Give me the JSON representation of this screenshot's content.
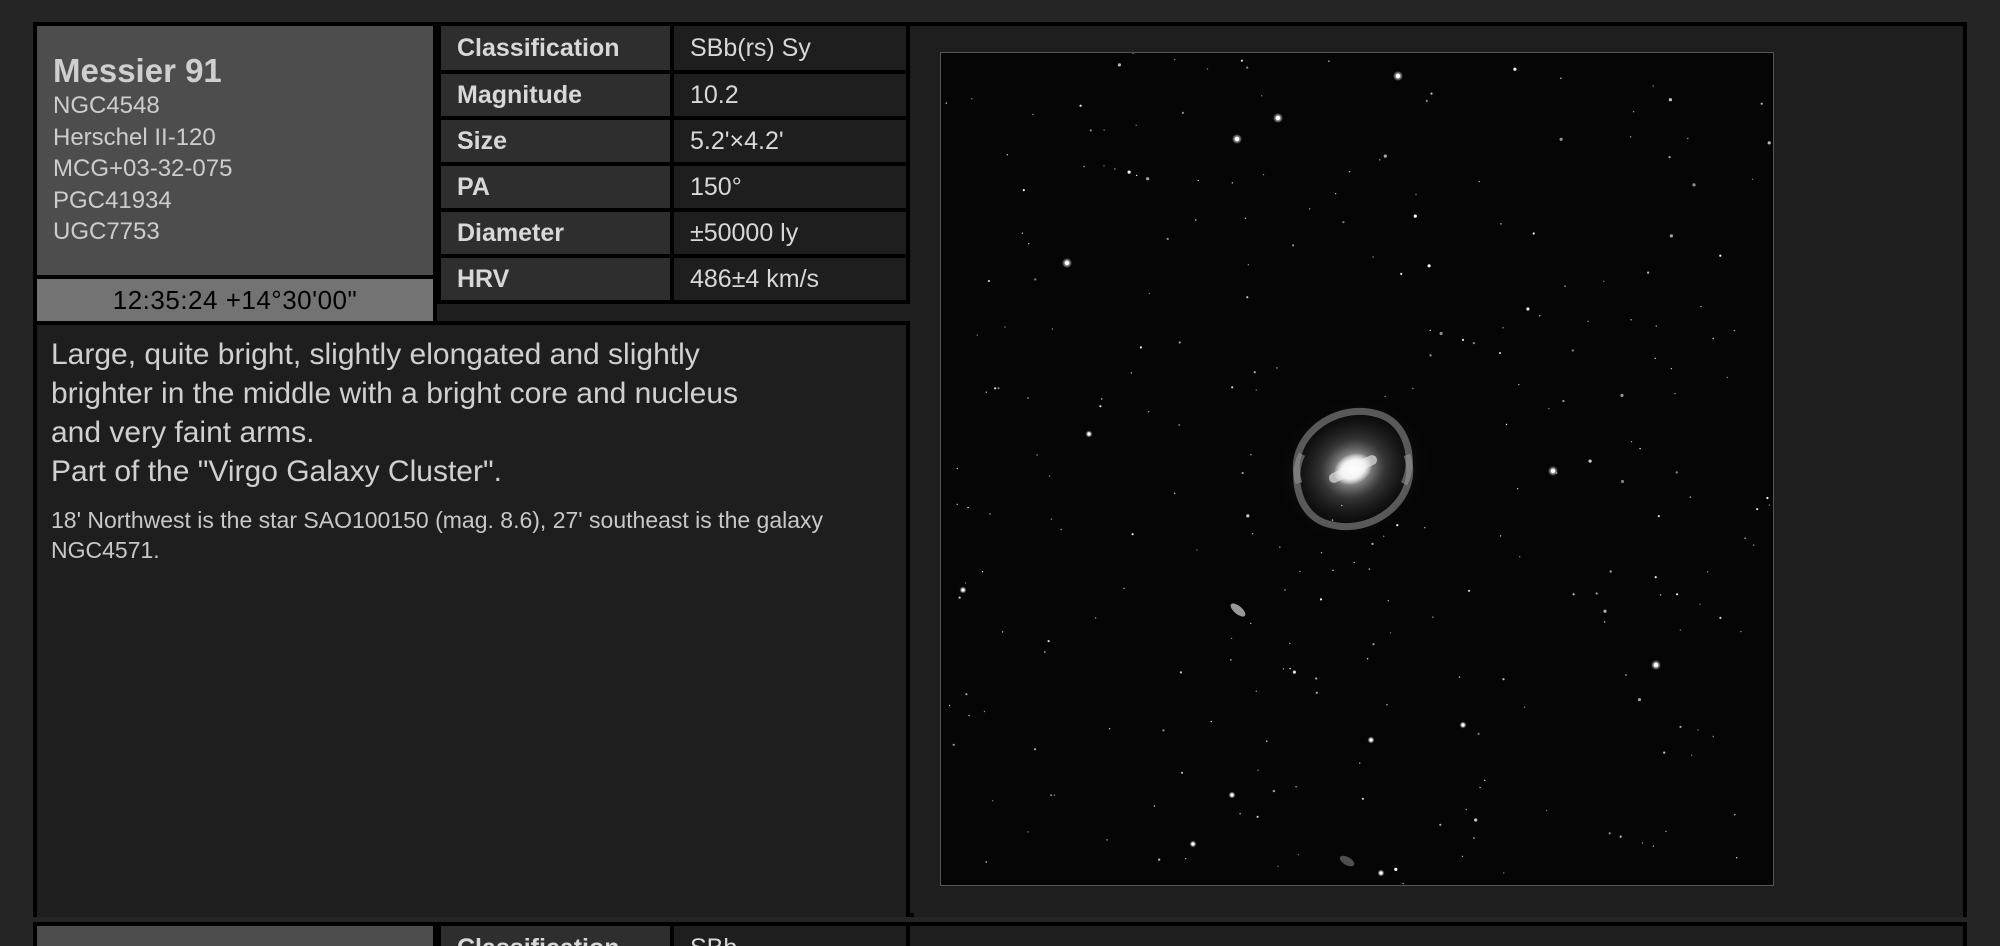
{
  "entries": [
    {
      "name": "Messier 91",
      "aliases": [
        "NGC4548",
        "Herschel II-120",
        "MCG+03-32-075",
        "PGC41934",
        "UGC7753"
      ],
      "coordinates": "12:35:24 +14°30'00\"",
      "properties": [
        {
          "label": "Classification",
          "value": "SBb(rs) Sy"
        },
        {
          "label": "Magnitude",
          "value": "10.2"
        },
        {
          "label": "Size",
          "value": "5.2'×4.2'"
        },
        {
          "label": "PA",
          "value": "150°"
        },
        {
          "label": "Diameter",
          "value": "±50000 ly"
        },
        {
          "label": "HRV",
          "value": "486±4 km/s"
        }
      ],
      "description_lines": [
        "Large, quite bright, slightly elongated and slightly",
        "brighter in the middle with a bright core and nucleus",
        "and very faint arms.",
        "Part of the \"Virgo Galaxy Cluster\"."
      ],
      "description_extra": "18' Northwest is the star SAO100150 (mag. 8.6), 27' southeast is the galaxy NGC4571."
    },
    {
      "properties": [
        {
          "label": "Classification",
          "value": "SBb"
        }
      ]
    }
  ],
  "colors": {
    "page_bg": "#252525",
    "panel_bg": "#1e1e1e",
    "name_panel_bg": "#4d4d4d",
    "coord_bar_bg": "#737373",
    "label_bg": "#2e2e2e",
    "border": "#000000"
  }
}
